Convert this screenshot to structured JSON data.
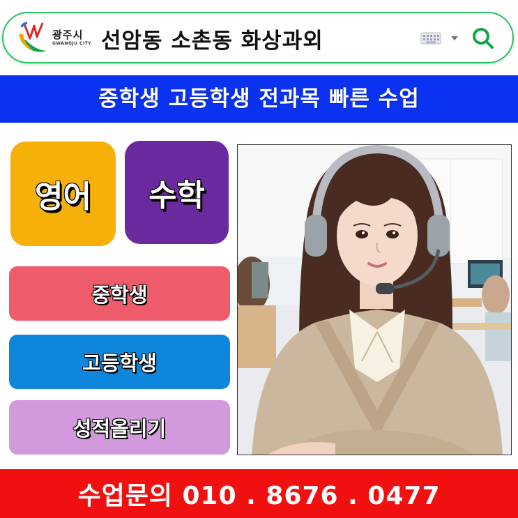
{
  "search_bar": {
    "city_name": "광주시",
    "city_english": "GWANGJU CITY",
    "query": "선암동 소촌동 화상과외",
    "icons": [
      "keyboard-icon",
      "chevron-down-icon",
      "search-icon"
    ]
  },
  "top_banner": {
    "text": "중학생 고등학생 전과목 빠른 수업",
    "color": "#0b32f0"
  },
  "subjects": [
    {
      "label": "영어",
      "color": "#f5b109"
    },
    {
      "label": "수학",
      "color": "#6a2a9e"
    }
  ],
  "buttons": [
    {
      "label": "중학생",
      "color": "#ee5b6b"
    },
    {
      "label": "고등학생",
      "color": "#0e86dc"
    },
    {
      "label": "성적올리기",
      "color": "#d29adc"
    }
  ],
  "footer": {
    "text": "수업문의 010 . 8676 . 0477",
    "color": "#f01010"
  },
  "accent_color": "#22c55e"
}
